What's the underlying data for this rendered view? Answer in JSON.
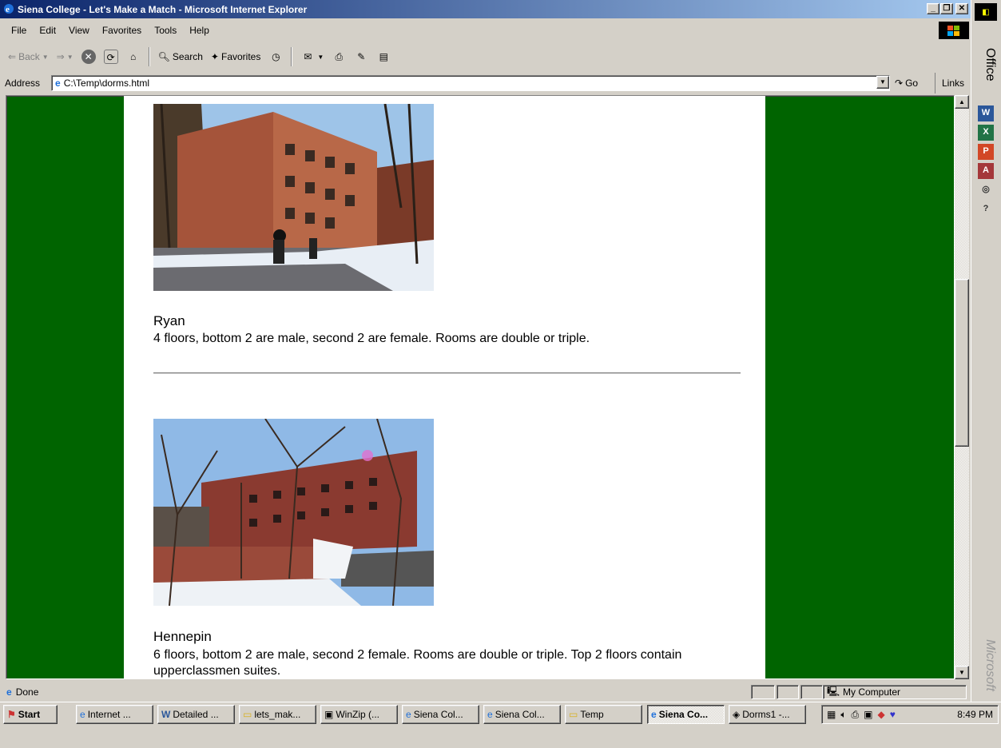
{
  "window": {
    "title": "Siena College - Let's Make a Match - Microsoft Internet Explorer"
  },
  "menu": [
    "File",
    "Edit",
    "View",
    "Favorites",
    "Tools",
    "Help"
  ],
  "toolbar": {
    "back": "Back",
    "search": "Search",
    "favorites": "Favorites"
  },
  "address": {
    "label": "Address",
    "url": "C:\\Temp\\dorms.html",
    "go": "Go",
    "links": "Links"
  },
  "dorms": [
    {
      "name": "Ryan",
      "description": " 4 floors, bottom 2 are male, second 2 are female. Rooms are double or triple."
    },
    {
      "name": "Hennepin",
      "description": "6 floors, bottom 2 are male, second 2 female. Rooms are double or triple. Top 2 floors contain upperclassmen suites."
    }
  ],
  "status": {
    "text": "Done",
    "zone": "My Computer"
  },
  "taskbar": {
    "start": "Start",
    "tasks": [
      "Internet ...",
      "Detailed ...",
      "lets_mak...",
      "WinZip (...",
      "Siena Col...",
      "Siena Col...",
      "Temp",
      "Siena Co...",
      "Dorms1 -..."
    ],
    "clock": "8:49 PM"
  },
  "office": {
    "label": "Office",
    "brand": "Microsoft"
  },
  "colors": {
    "page_bg": "#006400",
    "title_active": "#0a246a"
  }
}
